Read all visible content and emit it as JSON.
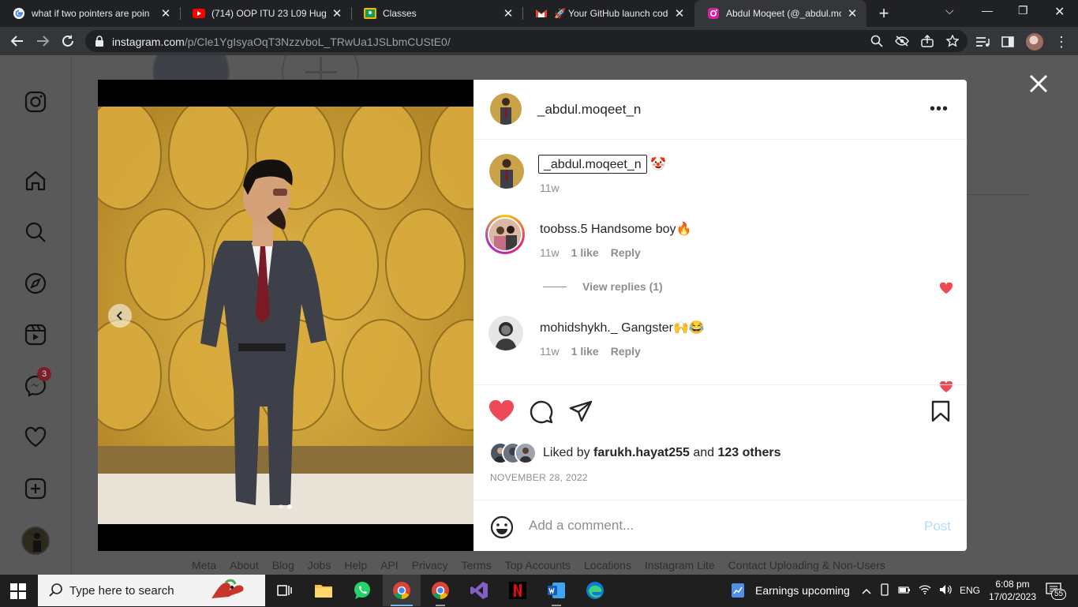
{
  "browser": {
    "tabs": [
      {
        "title": "what if two pointers are poin",
        "favicon": "google-icon"
      },
      {
        "title": "(714) OOP ITU 23 L09 Huge I",
        "favicon": "youtube-icon"
      },
      {
        "title": "Classes",
        "favicon": "google-classroom-icon"
      },
      {
        "title": "🚀 Your GitHub launch code",
        "favicon": "gmail-icon"
      },
      {
        "title": "Abdul Moqeet (@_abdul.mo",
        "favicon": "instagram-icon",
        "active": true
      }
    ],
    "url_domain": "instagram.com",
    "url_path": "/p/Cle1YgIsyaOqT3NzzvboL_TRwUa1JSLbmCUStE0/"
  },
  "instagram": {
    "sidebar_icons": [
      "instagram-logo-icon",
      "home-icon",
      "search-icon",
      "explore-icon",
      "reels-icon",
      "messenger-icon",
      "heart-icon",
      "create-icon",
      "profile-avatar"
    ],
    "messenger_badge": "3",
    "footer_links": [
      "Meta",
      "About",
      "Blog",
      "Jobs",
      "Help",
      "API",
      "Privacy",
      "Terms",
      "Top Accounts",
      "Locations",
      "Instagram Lite",
      "Contact Uploading & Non-Users"
    ],
    "post": {
      "author": "_abdul.moqeet_n",
      "more": "•••",
      "caption_user": "_abdul.moqeet_n",
      "caption_emoji": "🤡",
      "caption_time": "11w",
      "comments": [
        {
          "user": "toobss.5",
          "text": "Handsome boy🔥",
          "time": "11w",
          "likes": "1 like",
          "reply": "Reply",
          "view_replies": "View replies (1)"
        },
        {
          "user": "mohidshykh._",
          "text": "Gangster🙌😂",
          "time": "11w",
          "likes": "1 like",
          "reply": "Reply"
        }
      ],
      "liked_by_prefix": "Liked by",
      "liked_by_user": "farukh.hayat255",
      "liked_by_and": "and",
      "liked_by_others": "123 others",
      "date": "NOVEMBER 28, 2022",
      "comment_placeholder": "Add a comment...",
      "post_button": "Post",
      "carousel_index": 2,
      "carousel_total": 2
    }
  },
  "taskbar": {
    "search_placeholder": "Type here to search",
    "weather": "Earnings upcoming",
    "lang": "ENG",
    "time": "6:08 pm",
    "date": "17/02/2023",
    "notifications": "55"
  },
  "colors": {
    "like_red": "#ed4956",
    "post_blue_disabled": "#b3dbff",
    "chrome_dark": "#202124",
    "chrome_toolbar": "#35363a"
  }
}
